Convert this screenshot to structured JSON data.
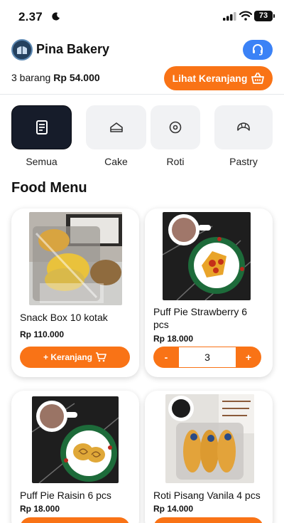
{
  "status_bar": {
    "time": "2.37",
    "battery": "73"
  },
  "header": {
    "brand": "Pina Bakery",
    "support_icon": "headset-icon",
    "logo_icon": "bakery-logo-icon"
  },
  "cart": {
    "count_label": "3 barang",
    "total": "Rp 54.000",
    "button_label": "Lihat Keranjang",
    "button_icon": "basket-icon"
  },
  "categories": [
    {
      "label": "Semua",
      "icon": "list-icon",
      "active": true
    },
    {
      "label": "Cake",
      "icon": "cake-icon",
      "active": false
    },
    {
      "label": "Roti",
      "icon": "donut-icon",
      "active": false
    },
    {
      "label": "Pastry",
      "icon": "croissant-icon",
      "active": false
    }
  ],
  "section_title": "Food Menu",
  "products": [
    {
      "name": "Snack Box 10 kotak",
      "price": "Rp 110.000",
      "action": "+ Keranjang",
      "action_icon": "cart-icon"
    },
    {
      "name": "Puff Pie Strawberry 6 pcs",
      "price": "Rp 18.000",
      "stepper": {
        "minus": "-",
        "qty": "3",
        "plus": "+"
      }
    },
    {
      "name": "Puff Pie Raisin 6 pcs",
      "price": "Rp 18.000"
    },
    {
      "name": "Roti Pisang Vanila 4 pcs",
      "price": "Rp 14.000"
    }
  ],
  "colors": {
    "accent": "#f97316",
    "support": "#3b82f6",
    "active_category": "#161c2a"
  }
}
